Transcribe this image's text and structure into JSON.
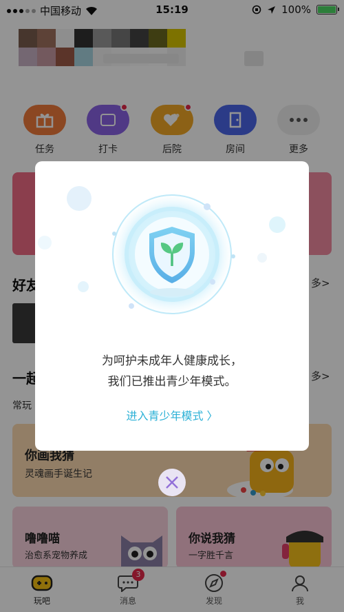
{
  "status_bar": {
    "carrier": "中国移动",
    "time": "15:19",
    "battery": "100%"
  },
  "quick_actions": [
    {
      "label": "任务",
      "color": "#f07a3c"
    },
    {
      "label": "打卡",
      "color": "#8b63e6"
    },
    {
      "label": "后院",
      "color": "#f2a826"
    },
    {
      "label": "房间",
      "color": "#4a66e8"
    },
    {
      "label": "更多",
      "color": "#eeeeee"
    }
  ],
  "sections": {
    "friends_partial": "好友",
    "together_partial": "一起",
    "common_partial": "常玩",
    "more_1": "多>",
    "more_2": "多>"
  },
  "cards": [
    {
      "title": "你画我猜",
      "subtitle": "灵魂画手诞生记"
    },
    {
      "title": "噜噜喵",
      "subtitle": "治愈系宠物养成"
    },
    {
      "title": "你说我猜",
      "subtitle": "一字胜千言"
    }
  ],
  "tabbar": {
    "items": [
      {
        "label": "玩吧"
      },
      {
        "label": "消息",
        "badge": "3"
      },
      {
        "label": "发现"
      },
      {
        "label": "我"
      }
    ]
  },
  "modal": {
    "line1": "为呵护未成年人健康成长，",
    "line2": "我们已推出青少年模式。",
    "link": "进入青少年模式 〉"
  }
}
